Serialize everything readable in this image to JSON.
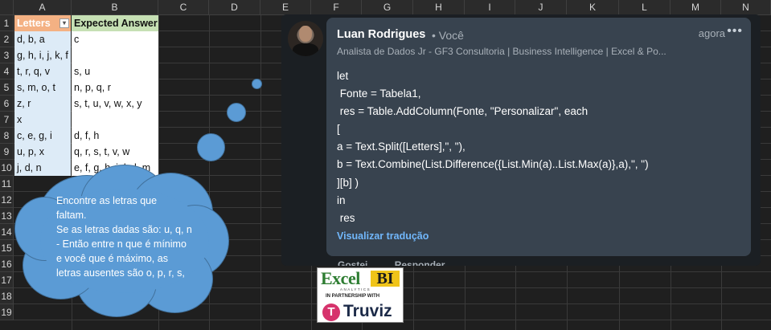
{
  "spreadsheet": {
    "columns": [
      "A",
      "B",
      "C",
      "D",
      "E",
      "F",
      "G",
      "H",
      "I",
      "J",
      "K",
      "L",
      "M",
      "N"
    ],
    "rows": [
      "1",
      "2",
      "3",
      "4",
      "5",
      "6",
      "7",
      "8",
      "9",
      "10",
      "11",
      "12",
      "13",
      "14",
      "15",
      "16",
      "17",
      "18",
      "19"
    ],
    "header_letters": "Letters",
    "header_expected": "Expected Answer",
    "data": [
      {
        "letters": "d, b, a",
        "expected": "c"
      },
      {
        "letters": "g, h, i, j, k, f",
        "expected": ""
      },
      {
        "letters": "t, r, q, v",
        "expected": "s, u"
      },
      {
        "letters": "s, m, o, t",
        "expected": "n, p, q, r"
      },
      {
        "letters": "z, r",
        "expected": "s, t, u, v, w, x, y"
      },
      {
        "letters": "x",
        "expected": ""
      },
      {
        "letters": "c, e, g, i",
        "expected": "d, f, h"
      },
      {
        "letters": "u, p, x",
        "expected": "q, r, s, t, v, w"
      },
      {
        "letters": "j, d, n",
        "expected": "e, f, g, h, i, k, l, m"
      }
    ],
    "colors": {
      "letters_header": "#f4b183",
      "expected_header": "#c6e0b4",
      "letters_fill": "#ddebf7"
    }
  },
  "callout": {
    "lines": [
      "Encontre as letras que",
      "faltam.",
      "Se as letras dadas são: u, q, n",
      "- Então entre n que é mínimo",
      "e você que é máximo, as",
      "letras ausentes são o, p, r, s,"
    ],
    "color": "#5b9bd5"
  },
  "comment": {
    "author": "Luan Rodrigues",
    "degree": "• Você",
    "time": "agora",
    "more_icon": "ellipsis-icon",
    "headline": "Analista de Dados Jr - GF3 Consultoria | Business Intelligence | Excel & Po...",
    "code_lines": [
      "let",
      " Fonte = Tabela1,",
      " res = Table.AddColumn(Fonte, \"Personalizar\", each",
      "[",
      "a = Text.Split([Letters],\", \"),",
      "b = Text.Combine(List.Difference({List.Min(a)..List.Max(a)},a),\", \")",
      "][b] )",
      "in",
      " res"
    ],
    "translate_link": "Visualizar tradução",
    "actions": [
      "Gostei",
      "Responder"
    ]
  },
  "logo": {
    "excel": "Excel",
    "bi": "BI",
    "analytics": "ANALYTICS",
    "partnership": "IN PARTNERSHIP WITH",
    "brand_mark": "T",
    "brand": "Truviz"
  }
}
